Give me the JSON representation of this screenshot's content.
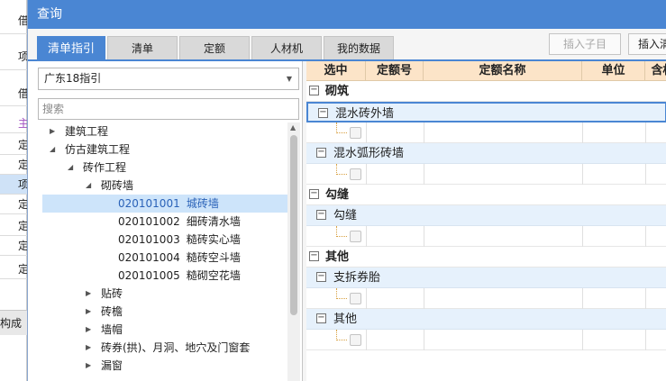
{
  "background": {
    "rows": [
      "借",
      "项",
      "借",
      "主",
      "定",
      "定",
      "项",
      "定",
      "定",
      "定",
      "定"
    ],
    "footer": "构成"
  },
  "dialog": {
    "title": "查询",
    "tabs": [
      "清单指引",
      "清单",
      "定额",
      "人材机",
      "我的数据"
    ],
    "buttons": {
      "insert_child": "插入子目",
      "insert_clear": "插入清"
    }
  },
  "left": {
    "dropdown_value": "广东18指引",
    "search_placeholder": "搜索",
    "tree": [
      {
        "label": "建筑工程"
      },
      {
        "label": "仿古建筑工程"
      },
      {
        "label": "砖作工程"
      },
      {
        "label": "砌砖墙"
      },
      {
        "code": "020101001",
        "label": "城砖墙"
      },
      {
        "code": "020101002",
        "label": "细砖清水墙"
      },
      {
        "code": "020101003",
        "label": "糙砖实心墙"
      },
      {
        "code": "020101004",
        "label": "糙砖空斗墙"
      },
      {
        "code": "020101005",
        "label": "糙砌空花墙"
      },
      {
        "label": "贴砖"
      },
      {
        "label": "砖檐"
      },
      {
        "label": "墙帽"
      },
      {
        "label": "砖券(拱)、月洞、地穴及门窗套"
      },
      {
        "label": "漏窗"
      }
    ]
  },
  "grid": {
    "headers": [
      "选中",
      "定额号",
      "定额名称",
      "单位",
      "含权"
    ],
    "groups": [
      {
        "name": "砌筑",
        "subs": [
          "混水砖外墙",
          "混水弧形砖墙"
        ]
      },
      {
        "name": "勾缝",
        "subs": [
          "勾缝"
        ]
      },
      {
        "name": "其他",
        "subs": [
          "支拆券胎",
          "其他"
        ]
      }
    ]
  },
  "colors": {
    "accent": "#4a86d3",
    "header_bg": "#fce4c8",
    "selected_row": "#cde4fa",
    "sub_row": "#e6f1fc"
  }
}
